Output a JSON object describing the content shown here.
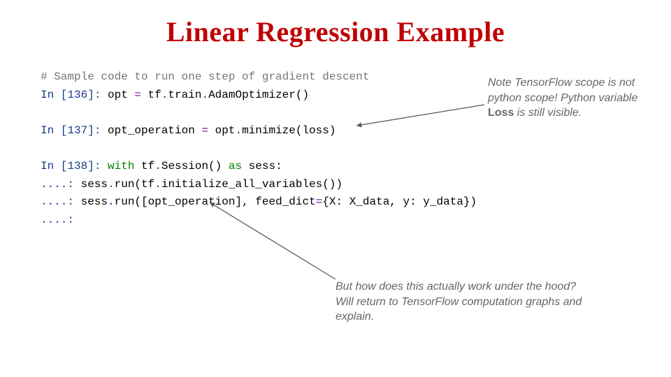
{
  "title": "Linear Regression Example",
  "code": {
    "comment": "# Sample code to run one step of gradient descent",
    "p1": "In [136]: ",
    "l1a": "opt ",
    "l1b": "= ",
    "l1c": "tf",
    "dot": ".",
    "l1d": "train",
    "l1e": "AdamOptimizer()",
    "p2": "In [137]: ",
    "l2a": "opt_operation ",
    "l2b": "= ",
    "l2c": "opt",
    "l2d": "minimize(loss)",
    "p3": "In [138]: ",
    "l3a": "with ",
    "l3b": "tf",
    "l3c": "Session() ",
    "l3d": "as ",
    "l3e": "sess:",
    "cont": "   ....: ",
    "indent": "    ",
    "l4a": "sess",
    "l4b": "run(tf",
    "l4c": "initialize_all_variables())",
    "l5a": "sess",
    "l5b": "run([opt_operation], feed_dict",
    "l5c": "=",
    "l5d": "{X: X_data, y: y_data})"
  },
  "notes": {
    "n1a": "Note TensorFlow scope is not python scope! Python variable ",
    "n1b": "Loss",
    "n1c": " is still visible.",
    "n2": "But how does this actually work under the hood? Will return to TensorFlow computation graphs and explain."
  }
}
